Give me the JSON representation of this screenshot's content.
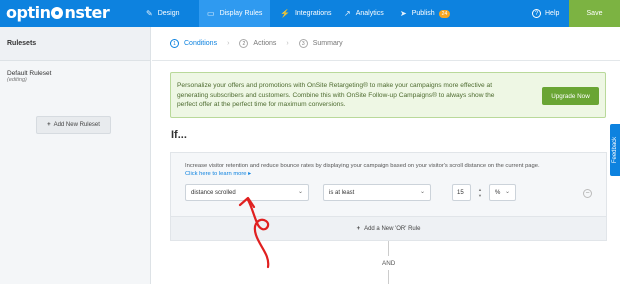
{
  "app": {
    "logo_text_a": "optin",
    "logo_text_b": "nster"
  },
  "nav": {
    "tabs": [
      {
        "label": "Design",
        "icon": "brush-icon"
      },
      {
        "label": "Display Rules",
        "icon": "monitor-icon",
        "active": true
      },
      {
        "label": "Integrations",
        "icon": "plug-icon"
      },
      {
        "label": "Analytics",
        "icon": "chart-icon"
      },
      {
        "label": "Publish",
        "icon": "send-icon",
        "badge": "24"
      }
    ],
    "help_label": "Help",
    "save_label": "Save"
  },
  "sidebar": {
    "heading": "Rulesets",
    "ruleset_title": "Default Ruleset",
    "ruleset_status": "(editing)",
    "add_label": "Add New Ruleset"
  },
  "steps": [
    {
      "num": "1",
      "label": "Conditions",
      "active": true
    },
    {
      "num": "2",
      "label": "Actions"
    },
    {
      "num": "3",
      "label": "Summary"
    }
  ],
  "promo": {
    "line1": "Personalize your offers and promotions with OnSite Retargeting® to make your campaigns more effective at",
    "line2": "generating subscribers and customers. Combine this with OnSite Follow-up Campaigns® to always show the",
    "line3": "perfect offer at the perfect time for maximum conversions.",
    "button": "Upgrade Now"
  },
  "rule": {
    "heading": "If...",
    "description": "Increase visitor retention and reduce bounce rates by displaying your campaign based on your visitor's scroll distance on the current page.",
    "link": "Click here to learn more ▸",
    "condition": "distance scrolled",
    "operator": "is at least",
    "value": "15",
    "unit": "%",
    "add_or": "Add a New 'OR' Rule",
    "and_label": "AND"
  },
  "feedback_label": "Feedback",
  "colors": {
    "brand_blue": "#0d82df",
    "save_green": "#7cb342",
    "annotation_red": "#e02020"
  }
}
